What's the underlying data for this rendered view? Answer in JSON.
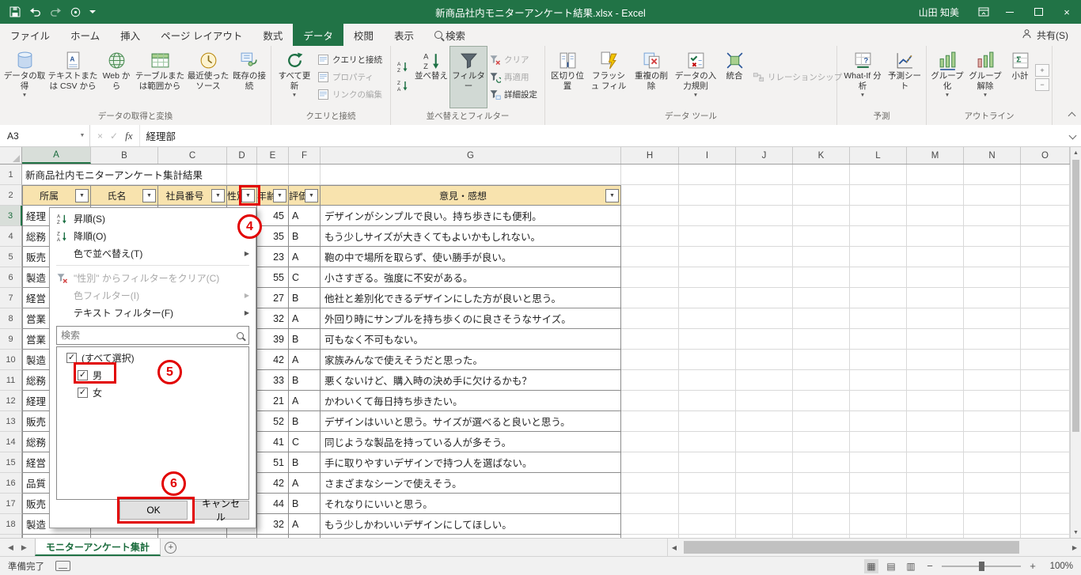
{
  "title_bar": {
    "title": "新商品社内モニターアンケート結果.xlsx - Excel",
    "user": "山田 知美"
  },
  "tabs": {
    "items": [
      "ファイル",
      "ホーム",
      "挿入",
      "ページ レイアウト",
      "数式",
      "データ",
      "校閲",
      "表示",
      "検索"
    ],
    "active": "データ",
    "search": "検索"
  },
  "share_label": "共有(S)",
  "ribbon": {
    "get": {
      "label": "データの取得と変換",
      "b1": "データの取得",
      "b2": "テキストまたは CSV から",
      "b3": "Web から",
      "b4": "テーブルまたは範囲から",
      "b5": "最近使ったソース",
      "b6": "既存の接続"
    },
    "queries": {
      "label": "クエリと接続",
      "b1": "すべて更新",
      "s1": "クエリと接続",
      "s2": "プロパティ",
      "s3": "リンクの編集"
    },
    "sort": {
      "label": "並べ替えとフィルター",
      "b1": "並べ替え",
      "b2": "フィルター",
      "s1": "クリア",
      "s2": "再適用",
      "s3": "詳細設定"
    },
    "tools": {
      "label": "データ ツール",
      "b1": "区切り位置",
      "b2": "フラッシュ フィル",
      "b3": "重複の削除",
      "b4": "データの入力規則",
      "b5": "統合",
      "b6": "リレーションシップ"
    },
    "forecast": {
      "label": "予測",
      "b1": "What-If 分析",
      "b2": "予測シート"
    },
    "outline": {
      "label": "アウトライン",
      "b1": "グループ化",
      "b2": "グループ解除",
      "b3": "小計"
    }
  },
  "formula_bar": {
    "name_box": "A3",
    "value": "経理部"
  },
  "grid": {
    "columns": [
      "A",
      "B",
      "C",
      "D",
      "E",
      "F",
      "G",
      "H",
      "I",
      "J",
      "K",
      "L",
      "M",
      "N",
      "O"
    ],
    "title_cell": "新商品社内モニターアンケート集計結果",
    "headers": {
      "A": "所属",
      "B": "氏名",
      "C": "社員番号",
      "D": "性別",
      "E": "年齢",
      "F": "評価",
      "G": "意見・感想"
    },
    "rows": [
      {
        "n": 3,
        "dept": "経理",
        "age": "45",
        "rating": "A",
        "comment": "デザインがシンプルで良い。持ち歩きにも便利。"
      },
      {
        "n": 4,
        "dept": "総務",
        "age": "35",
        "rating": "B",
        "comment": "もう少しサイズが大きくてもよいかもしれない。"
      },
      {
        "n": 5,
        "dept": "販売",
        "age": "23",
        "rating": "A",
        "comment": "鞄の中で場所を取らず、使い勝手が良い。"
      },
      {
        "n": 6,
        "dept": "製造",
        "age": "55",
        "rating": "C",
        "comment": "小さすぎる。強度に不安がある。"
      },
      {
        "n": 7,
        "dept": "経営",
        "age": "27",
        "rating": "B",
        "comment": "他社と差別化できるデザインにした方が良いと思う。"
      },
      {
        "n": 8,
        "dept": "営業",
        "age": "32",
        "rating": "A",
        "comment": "外回り時にサンプルを持ち歩くのに良さそうなサイズ。"
      },
      {
        "n": 9,
        "dept": "営業",
        "age": "39",
        "rating": "B",
        "comment": "可もなく不可もない。"
      },
      {
        "n": 10,
        "dept": "製造",
        "age": "42",
        "rating": "A",
        "comment": "家族みんなで使えそうだと思った。"
      },
      {
        "n": 11,
        "dept": "総務",
        "age": "33",
        "rating": "B",
        "comment": "悪くないけど、購入時の決め手に欠けるかも？"
      },
      {
        "n": 12,
        "dept": "経理",
        "age": "21",
        "rating": "A",
        "comment": "かわいくて毎日持ち歩きたい。"
      },
      {
        "n": 13,
        "dept": "販売",
        "age": "52",
        "rating": "B",
        "comment": "デザインはいいと思う。サイズが選べると良いと思う。"
      },
      {
        "n": 14,
        "dept": "総務",
        "age": "41",
        "rating": "C",
        "comment": "同じような製品を持っている人が多そう。"
      },
      {
        "n": 15,
        "dept": "経営",
        "age": "51",
        "rating": "B",
        "comment": "手に取りやすいデザインで持つ人を選ばない。"
      },
      {
        "n": 16,
        "dept": "品質",
        "age": "42",
        "rating": "A",
        "comment": "さまざまなシーンで使えそう。"
      },
      {
        "n": 17,
        "dept": "販売",
        "age": "44",
        "rating": "B",
        "comment": "それなりにいいと思う。"
      },
      {
        "n": 18,
        "dept": "製造",
        "age": "32",
        "rating": "A",
        "comment": "もう少しかわいいデザインにしてほしい。"
      }
    ]
  },
  "filter_menu": {
    "sort_asc": "昇順(S)",
    "sort_desc": "降順(O)",
    "sort_color": "色で並べ替え(T)",
    "clear": "\"性別\" からフィルターをクリア(C)",
    "color_filter": "色フィルター(I)",
    "text_filter": "テキスト フィルター(F)",
    "search_placeholder": "検索",
    "items": [
      {
        "label": "(すべて選択)",
        "checked": true
      },
      {
        "label": "男",
        "checked": true
      },
      {
        "label": "女",
        "checked": true
      }
    ],
    "ok": "OK",
    "cancel": "キャンセル"
  },
  "annotations": {
    "s4": "4",
    "s5": "5",
    "s6": "6"
  },
  "sheet_bar": {
    "active_tab": "モニターアンケート集計"
  },
  "status_bar": {
    "ready": "準備完了",
    "zoom": "100%"
  }
}
